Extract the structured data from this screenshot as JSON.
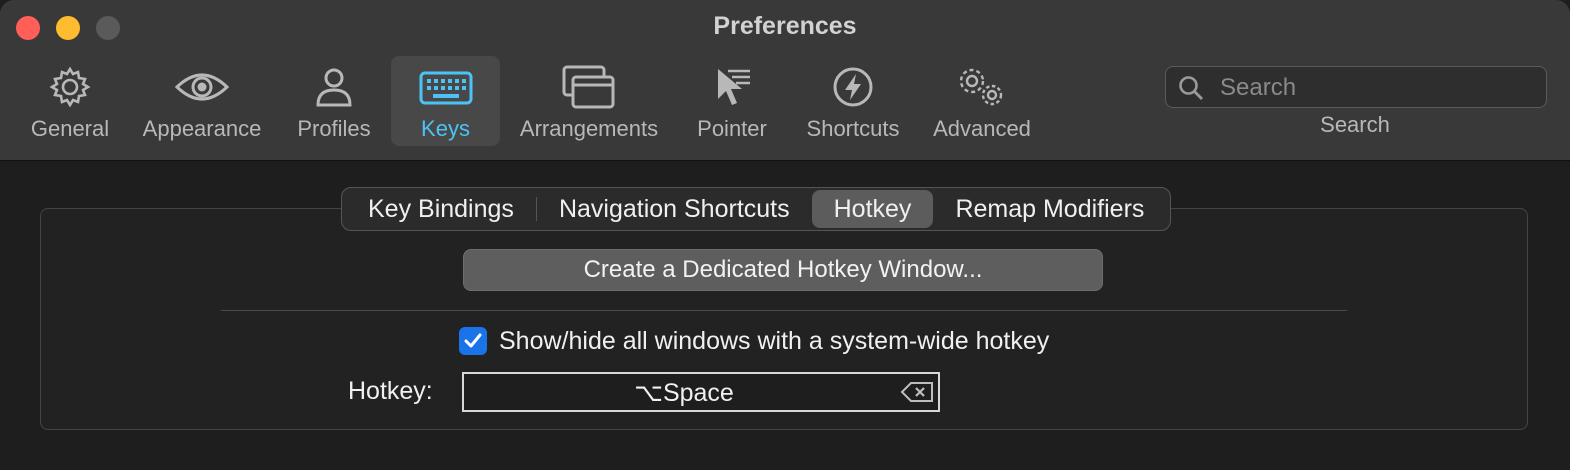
{
  "window": {
    "title": "Preferences"
  },
  "toolbar": {
    "items": [
      {
        "label": "General",
        "icon": "gear-icon"
      },
      {
        "label": "Appearance",
        "icon": "eye-icon"
      },
      {
        "label": "Profiles",
        "icon": "person-icon"
      },
      {
        "label": "Keys",
        "icon": "keyboard-icon",
        "active": true
      },
      {
        "label": "Arrangements",
        "icon": "windows-icon"
      },
      {
        "label": "Pointer",
        "icon": "pointer-icon"
      },
      {
        "label": "Shortcuts",
        "icon": "bolt-icon"
      },
      {
        "label": "Advanced",
        "icon": "gears-icon"
      }
    ],
    "search": {
      "placeholder": "Search",
      "caption": "Search"
    }
  },
  "tabs": {
    "items": [
      {
        "label": "Key Bindings"
      },
      {
        "label": "Navigation Shortcuts"
      },
      {
        "label": "Hotkey",
        "active": true
      },
      {
        "label": "Remap Modifiers"
      }
    ]
  },
  "hotkey_pane": {
    "dedicated_button_label": "Create a Dedicated Hotkey Window...",
    "show_hide_checkbox": {
      "label": "Show/hide all windows with a system-wide hotkey",
      "checked": true
    },
    "hotkey_label": "Hotkey:",
    "hotkey_value": "⌥Space"
  },
  "colors": {
    "accent": "#4cc3f6",
    "checkbox": "#1a73e8",
    "close": "#ff5f57",
    "minimize": "#febc2e",
    "zoom_disabled": "#5a5a5a"
  }
}
